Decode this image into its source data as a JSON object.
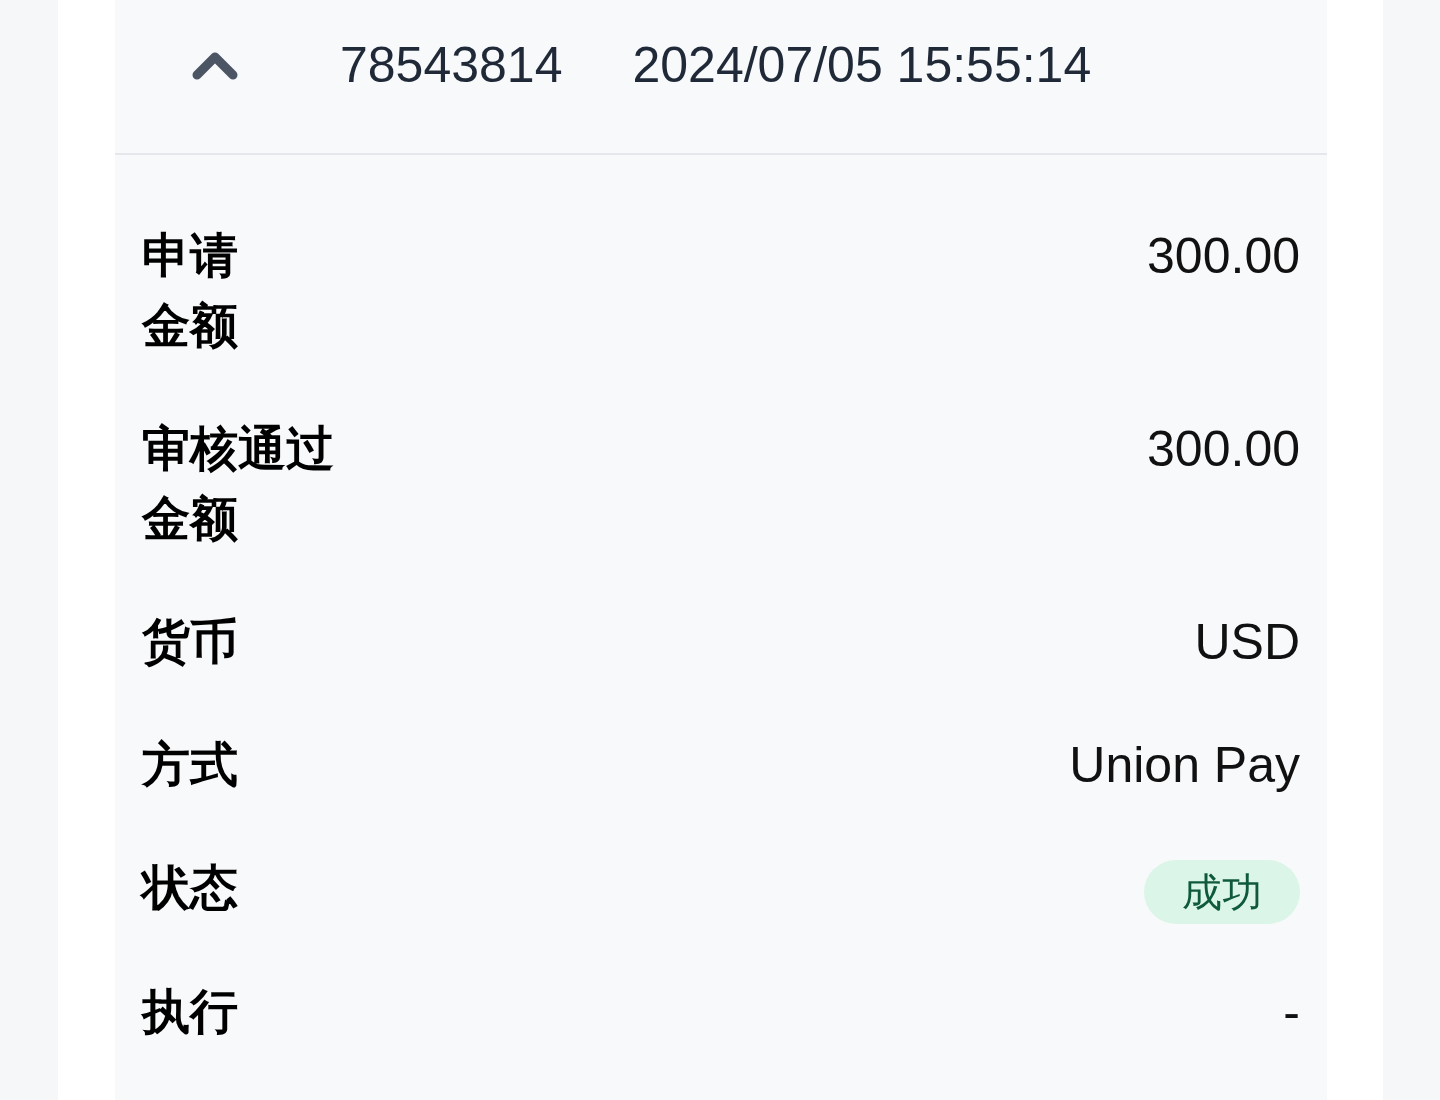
{
  "record": {
    "expanded": true,
    "id": "78543814",
    "time": "2024/07/05 15:55:14"
  },
  "fields": [
    {
      "kind": "text",
      "label": [
        "申请",
        "金额"
      ],
      "value": "300.00"
    },
    {
      "kind": "text",
      "label": [
        "审核通过",
        "金额"
      ],
      "value": "300.00"
    },
    {
      "kind": "text",
      "label": [
        "货币"
      ],
      "value": "USD"
    },
    {
      "kind": "text",
      "label": [
        "方式"
      ],
      "value": "Union Pay"
    },
    {
      "kind": "badge",
      "label": [
        "状态"
      ],
      "value": "成功"
    },
    {
      "kind": "text",
      "label": [
        "执行"
      ],
      "value": "-"
    }
  ]
}
